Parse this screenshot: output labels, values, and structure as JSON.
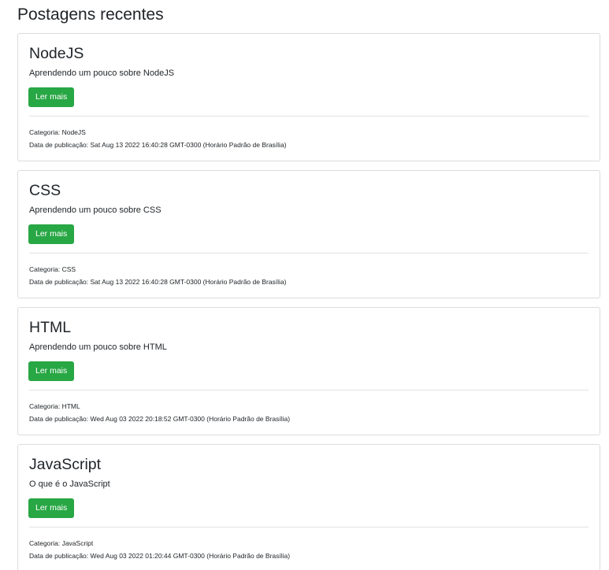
{
  "page": {
    "title": "Postagens recentes"
  },
  "posts": [
    {
      "title": "NodeJS",
      "description": "Aprendendo um pouco sobre NodeJS",
      "button_label": "Ler mais",
      "category": "Categoria: NodeJS",
      "date": "Data de publicação: Sat Aug 13 2022 16:40:28 GMT-0300 (Horário Padrão de Brasília)"
    },
    {
      "title": "CSS",
      "description": "Aprendendo um pouco sobre CSS",
      "button_label": "Ler mais",
      "category": "Categoria: CSS",
      "date": "Data de publicação: Sat Aug 13 2022 16:40:28 GMT-0300 (Horário Padrão de Brasília)"
    },
    {
      "title": "HTML",
      "description": "Aprendendo um pouco sobre HTML",
      "button_label": "Ler mais",
      "category": "Categoria: HTML",
      "date": "Data de publicação: Wed Aug 03 2022 20:18:52 GMT-0300 (Horário Padrão de Brasília)"
    },
    {
      "title": "JavaScript",
      "description": "O que é o JavaScript",
      "button_label": "Ler mais",
      "category": "Categoria: JavaScript",
      "date": "Data de publicação: Wed Aug 03 2022 01:20:44 GMT-0300 (Horário Padrão de Brasília)"
    }
  ],
  "colors": {
    "button_bg": "#28a745",
    "button_text": "#ffffff",
    "card_border": "#dcdcdc",
    "text": "#212529"
  }
}
